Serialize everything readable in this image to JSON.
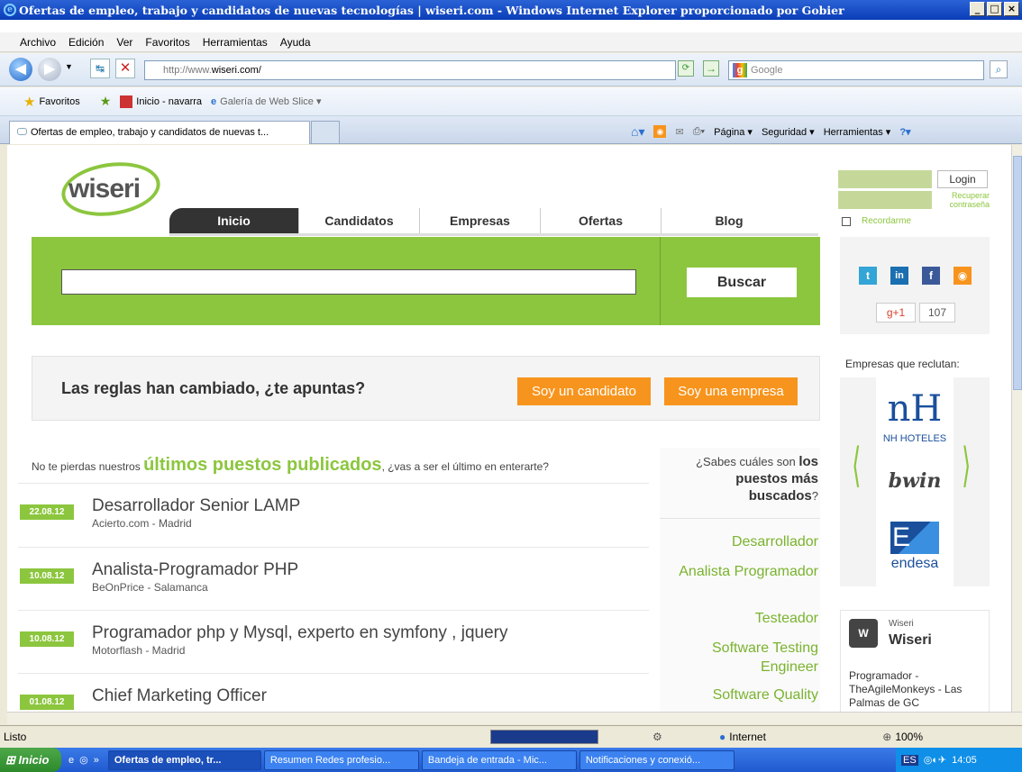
{
  "window": {
    "title": "Ofertas de empleo, trabajo y candidatos de nuevas tecnologías | wiseri.com - Windows Internet Explorer proporcionado por Gobier"
  },
  "menu": [
    "Archivo",
    "Edición",
    "Ver",
    "Favoritos",
    "Herramientas",
    "Ayuda"
  ],
  "address": {
    "prefix": "http://www.",
    "domain": "wiseri.com/",
    "search_placeholder": "Google"
  },
  "favorites": {
    "label": "Favoritos",
    "items": [
      "Inicio - navarra",
      "Galería de Web Slice ▾"
    ]
  },
  "tab": {
    "title": "Ofertas de empleo, trabajo y candidatos de nuevas t..."
  },
  "commandbar": [
    "Página ▾",
    "Seguridad ▾",
    "Herramientas ▾"
  ],
  "site": {
    "logo": "wiseri",
    "nav": [
      "Inicio",
      "Candidatos",
      "Empresas",
      "Ofertas",
      "Blog"
    ],
    "login": {
      "button": "Login",
      "recover": "Recuperar contraseña",
      "remember": "Recordarme"
    },
    "search": {
      "button": "Buscar"
    },
    "gplus": {
      "label": "+1",
      "count": "107"
    },
    "banner": {
      "text": "Las reglas han cambiado, ¿te apuntas?",
      "btn_candidate": "Soy un candidato",
      "btn_company": "Soy una empresa"
    },
    "jobs_intro": {
      "pre": "No te pierdas nuestros",
      "highlight": "últimos puestos publicados",
      "post": ", ¿vas a ser el último en enterarte?"
    },
    "jobs": [
      {
        "date": "22.08.12",
        "title": "Desarrollador Senior LAMP",
        "company": "Acierto.com - Madrid"
      },
      {
        "date": "10.08.12",
        "title": "Analista-Programador PHP",
        "company": "BeOnPrice - Salamanca"
      },
      {
        "date": "10.08.12",
        "title": "Programador php y Mysql, experto en symfony , jquery",
        "company": "Motorflash - Madrid"
      },
      {
        "date": "01.08.12",
        "title": "Chief Marketing Officer",
        "company": ""
      }
    ],
    "popular": {
      "pre": "¿Sabes cuáles son",
      "bold": "los puestos más buscados",
      "post": "?",
      "items": [
        "Desarrollador",
        "Analista Programador",
        "Testeador",
        "Software Testing Engineer",
        "Software Quality"
      ]
    },
    "recruiters": {
      "title": "Empresas que reclutan:",
      "logos": [
        "NH HOTELES",
        "bwin",
        "endesa"
      ]
    },
    "widget": {
      "small": "Wiseri",
      "name": "Wiseri",
      "text": "Programador - TheAgileMonkeys - Las Palmas de GC"
    }
  },
  "status": {
    "text": "Listo",
    "zone": "Internet",
    "zoom": "100%"
  },
  "taskbar": {
    "start": "Inicio",
    "tasks": [
      "Ofertas de empleo, tr...",
      "Resumen Redes profesio...",
      "Bandeja de entrada - Mic...",
      "Notificaciones y conexió..."
    ],
    "clock": "14:05",
    "lang": "ES"
  },
  "colors": {
    "brand_green": "#8cc63e",
    "orange": "#f7941d",
    "nav_dark": "#333333"
  }
}
